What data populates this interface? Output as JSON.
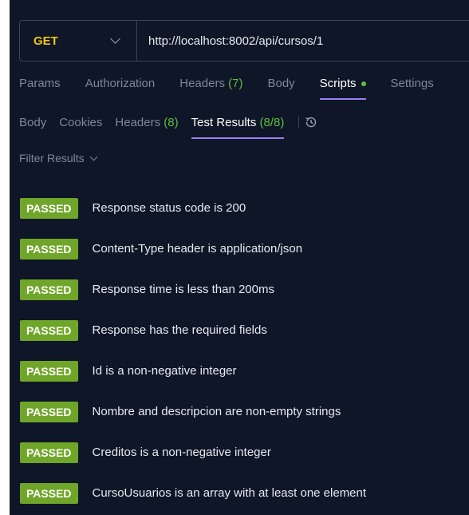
{
  "request": {
    "method": "GET",
    "url": "http://localhost:8002/api/cursos/1"
  },
  "tabs": [
    {
      "label": "Params"
    },
    {
      "label": "Authorization"
    },
    {
      "label": "Headers",
      "count": "(7)"
    },
    {
      "label": "Body"
    },
    {
      "label": "Scripts"
    },
    {
      "label": "Settings"
    }
  ],
  "response_tabs": [
    {
      "label": "Body"
    },
    {
      "label": "Cookies"
    },
    {
      "label": "Headers",
      "count": "(8)"
    },
    {
      "label": "Test Results",
      "count": "(8/8)"
    }
  ],
  "filter": {
    "label": "Filter Results"
  },
  "results": [
    {
      "status": "PASSED",
      "text": "Response status code is 200"
    },
    {
      "status": "PASSED",
      "text": "Content-Type header is application/json"
    },
    {
      "status": "PASSED",
      "text": "Response time is less than 200ms"
    },
    {
      "status": "PASSED",
      "text": "Response has the required fields"
    },
    {
      "status": "PASSED",
      "text": "Id is a non-negative integer"
    },
    {
      "status": "PASSED",
      "text": "Nombre and descripcion are non-empty strings"
    },
    {
      "status": "PASSED",
      "text": "Creditos is a non-negative integer"
    },
    {
      "status": "PASSED",
      "text": "CursoUsuarios is an array with at least one element"
    }
  ],
  "icons": {
    "method_dropdown": "chevron-down-icon",
    "scripts_indicator": "status-dot-icon",
    "history": "history-icon",
    "filter_dropdown": "chevron-down-icon"
  },
  "colors": {
    "background": "#0e1627",
    "method": "#f0c419",
    "passed": "#6fa62a",
    "count": "#5fbf3c",
    "active_underline": "#9b7ff0"
  }
}
